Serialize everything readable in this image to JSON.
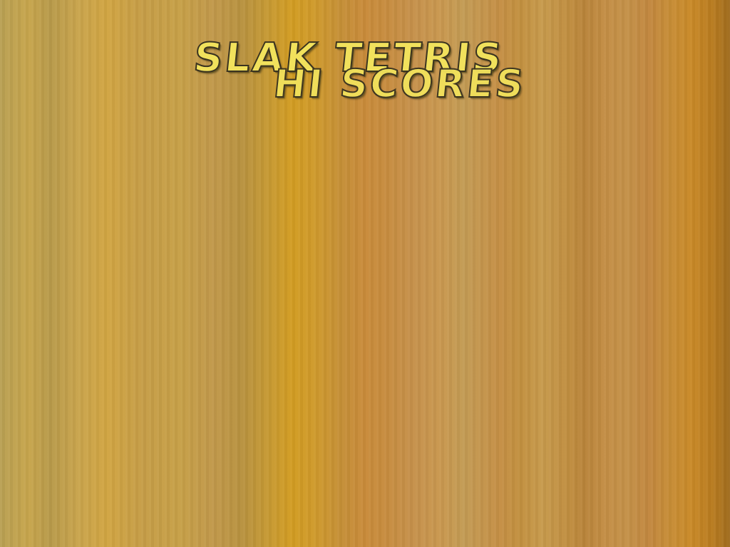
{
  "game": {
    "title": "SLAK TETRIS",
    "subtitle": "HI SCORES"
  },
  "colors": {
    "title_fill": "#f1e15c",
    "title_outline": "#3a3320",
    "background_gold": "#c9983e"
  }
}
